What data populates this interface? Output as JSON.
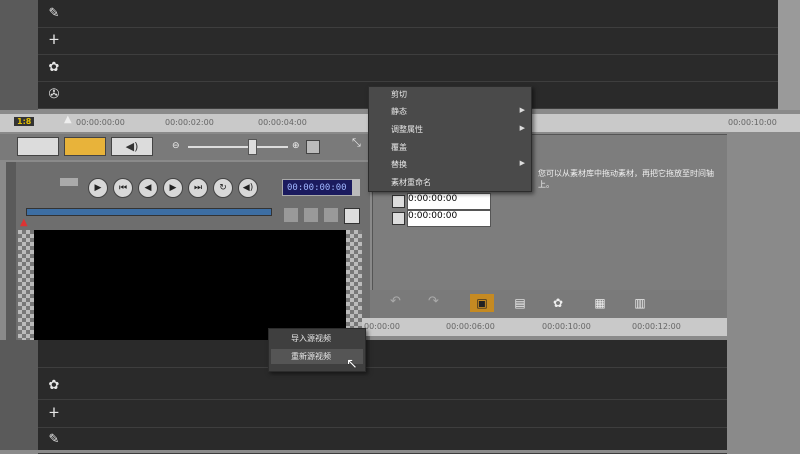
{
  "top_timeline": {
    "track_icons": [
      {
        "icon": "mic-icon",
        "glyph": "✎"
      },
      {
        "icon": "title-icon",
        "glyph": "ⵜ"
      },
      {
        "icon": "effect-icon",
        "glyph": "✿"
      },
      {
        "icon": "film-reel-icon",
        "glyph": "✇"
      }
    ],
    "ruler_ticks": [
      "00:00:00:00",
      "00:00:02:00",
      "00:00:04:00",
      "00:00:10:00"
    ],
    "zoom_label": "1:8"
  },
  "mode_tabs": [
    "storyboard",
    "timeline",
    "audio"
  ],
  "player": {
    "timecode": "00:00:00:00",
    "controls": [
      "play",
      "home",
      "prev",
      "next",
      "end",
      "repeat",
      "volume"
    ]
  },
  "context_menu_top": {
    "items": [
      {
        "label": "剪切",
        "submenu": false
      },
      {
        "label": "静态",
        "submenu": true
      },
      {
        "label": "调整属性",
        "submenu": true
      },
      {
        "label": "覆盖",
        "submenu": false
      },
      {
        "label": "替换",
        "submenu": true
      },
      {
        "label": "素材重命名",
        "submenu": false
      }
    ]
  },
  "info_panel": {
    "hint_text": "您可以从素材库中拖动素材，再把它拖放至时间轴上。",
    "timecodes": [
      "0:00:00:00",
      "0:00:00:00"
    ]
  },
  "context_menu_bottom": {
    "items": [
      "导入源视频",
      "重新源视频"
    ]
  },
  "bottom_timeline": {
    "ruler_ticks": [
      "00:00:00",
      "00:00:06:00",
      "00:00:10:00",
      "00:00:12:00"
    ],
    "track_icons": [
      {
        "icon": "effect-icon",
        "glyph": "✿"
      },
      {
        "icon": "title-icon",
        "glyph": "ⵜ"
      },
      {
        "icon": "mic-icon",
        "glyph": "✎"
      }
    ]
  }
}
